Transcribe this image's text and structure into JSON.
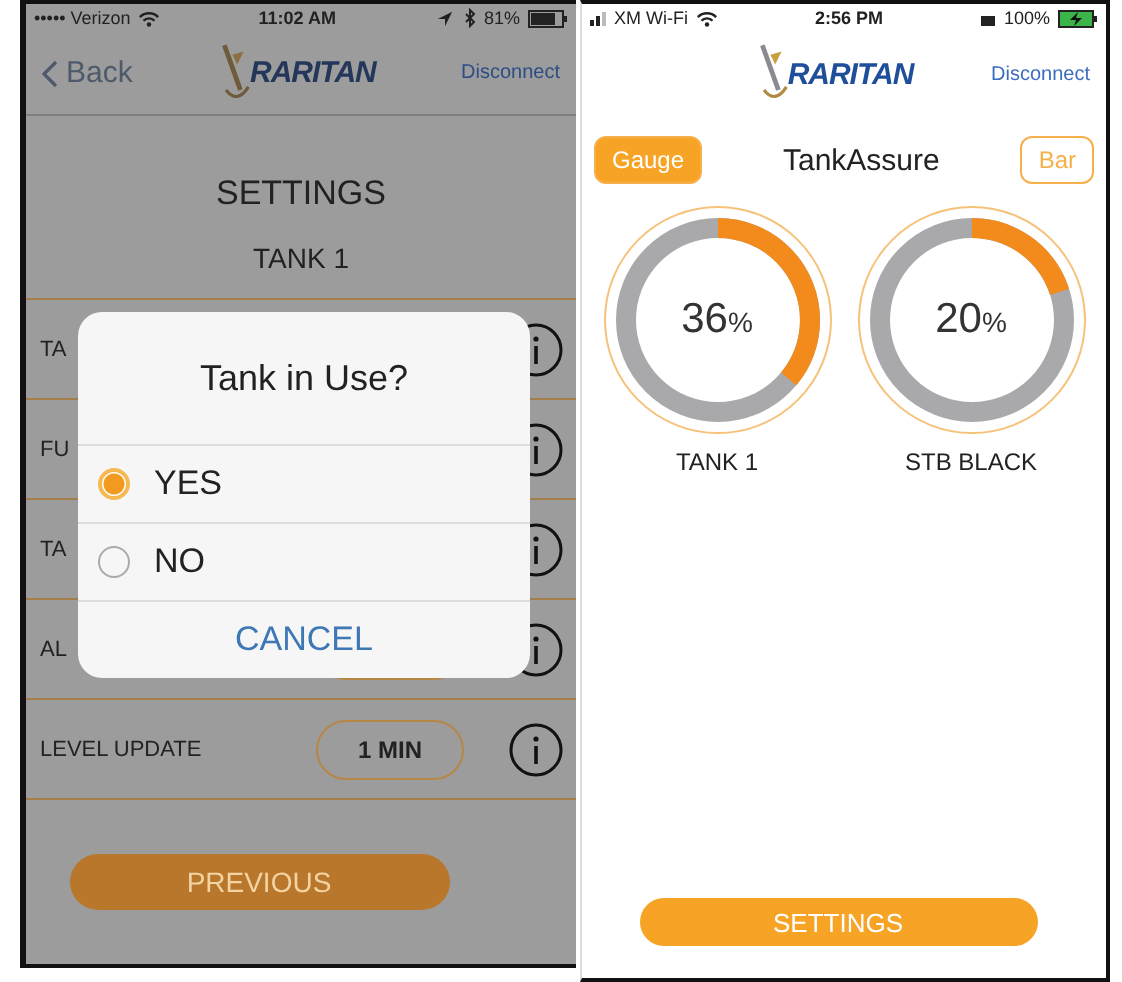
{
  "left_screen": {
    "status_bar": {
      "carrier": "••••• Verizon",
      "time": "11:02 AM",
      "battery": "81%"
    },
    "nav_bar": {
      "back": "Back",
      "logo": "RARITAN",
      "disconnect": "Disconnect"
    },
    "title": "SETTINGS",
    "subtitle": "TANK 1",
    "rows": [
      {
        "label": "TA",
        "value_button": false
      },
      {
        "label": "FU",
        "value_button": false
      },
      {
        "label": "TA",
        "value_button": false
      },
      {
        "label": "AL",
        "value_button": true
      },
      {
        "label": "LEVEL UPDATE",
        "value_button": true,
        "value": "1 MIN"
      }
    ],
    "previous_button": "PREVIOUS",
    "dialog": {
      "title": "Tank in Use?",
      "options": [
        {
          "label": "YES",
          "selected": true
        },
        {
          "label": "NO",
          "selected": false
        }
      ],
      "cancel": "CANCEL"
    }
  },
  "right_screen": {
    "status_bar": {
      "carrier": "XM Wi-Fi",
      "time": "2:56 PM",
      "battery": "100%"
    },
    "nav_bar": {
      "logo": "RARITAN",
      "disconnect": "Disconnect"
    },
    "view_tabs": [
      {
        "label": "Gauge",
        "selected": true
      },
      {
        "label": "Bar",
        "selected": false
      }
    ],
    "app_title": "TankAssure",
    "gauges": [
      {
        "name": "TANK 1",
        "reading": "36",
        "unit": "%",
        "level": 0.36
      },
      {
        "name": "STB BLACK",
        "reading": "20",
        "unit": "%",
        "level": 0.2
      }
    ],
    "settings_button": "SETTINGS"
  }
}
